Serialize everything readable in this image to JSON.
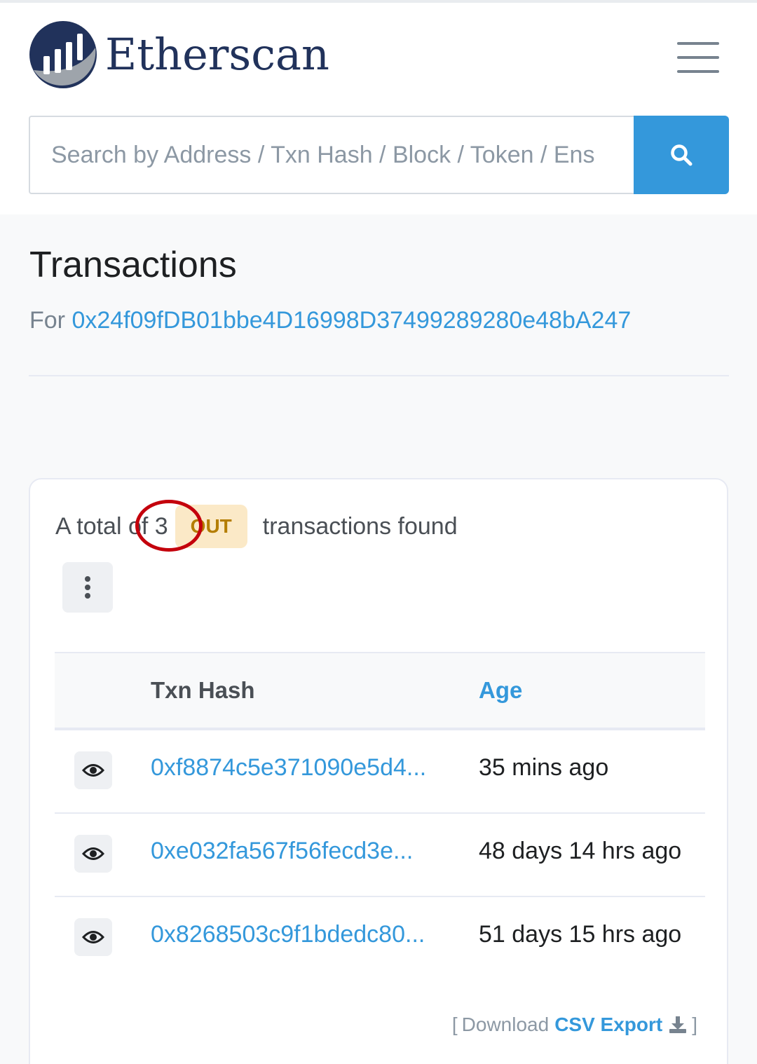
{
  "brand": {
    "name": "Etherscan"
  },
  "search": {
    "placeholder": "Search by Address / Txn Hash / Block / Token / Ens",
    "icon": "search-icon"
  },
  "page": {
    "title": "Transactions",
    "for_label": "For",
    "address": "0x24f09fDB01bbe4D16998D37499289280e48bA247"
  },
  "summary": {
    "prefix": "A total of 3",
    "badge": "OUT",
    "suffix": "transactions found"
  },
  "table": {
    "headers": {
      "hash": "Txn Hash",
      "age": "Age"
    },
    "rows": [
      {
        "hash": "0xf8874c5e371090e5d4...",
        "age": "35 mins ago"
      },
      {
        "hash": "0xe032fa567f56fecd3e...",
        "age": "48 days 14 hrs ago"
      },
      {
        "hash": "0x8268503c9f1bdedc80...",
        "age": "51 days 15 hrs ago"
      }
    ]
  },
  "export": {
    "open": "[",
    "prefix": "Download",
    "link": "CSV Export",
    "close": "]"
  },
  "colors": {
    "accent": "#3498db",
    "brand_navy": "#21325b",
    "badge_bg": "#fbe9c7",
    "badge_text": "#b47d00",
    "annotation": "#c4000c"
  }
}
